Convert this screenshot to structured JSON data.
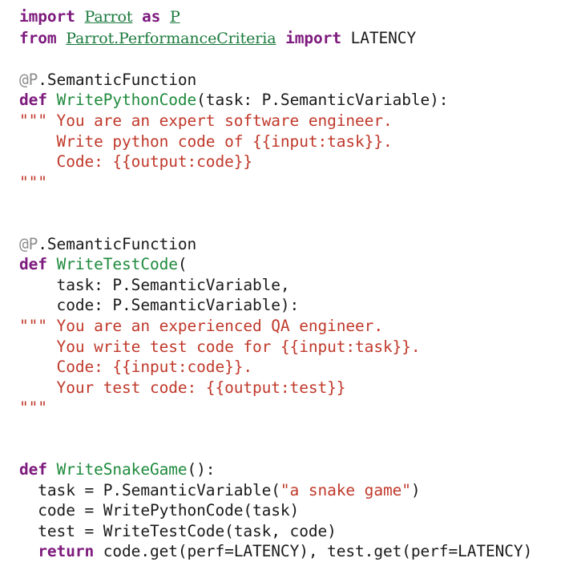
{
  "editor": {
    "title": "Parrot Semantic Function Code Listing",
    "language": "python",
    "colors": {
      "background": "#ffffff",
      "keyword": "#7d1a7d",
      "module_link": "#1a7a3c",
      "function_name": "#1e8a3c",
      "string": "#c0392b",
      "docstring": "#c0392b",
      "decorator_at": "#8c8c8c",
      "plain_text": "#1a1a1a"
    }
  },
  "lines": [
    {
      "id": "line-1",
      "tokens": [
        {
          "t": "import",
          "k": "keyword"
        },
        {
          "t": " ",
          "k": "plain"
        },
        {
          "t": "Parrot",
          "k": "module"
        },
        {
          "t": " ",
          "k": "plain"
        },
        {
          "t": "as",
          "k": "keyword"
        },
        {
          "t": " ",
          "k": "plain"
        },
        {
          "t": "P",
          "k": "module"
        }
      ]
    },
    {
      "id": "line-2",
      "tokens": [
        {
          "t": "from",
          "k": "keyword"
        },
        {
          "t": " ",
          "k": "plain"
        },
        {
          "t": "Parrot.PerformanceCriteria",
          "k": "module"
        },
        {
          "t": " ",
          "k": "plain"
        },
        {
          "t": "import",
          "k": "keyword"
        },
        {
          "t": " LATENCY",
          "k": "plain"
        }
      ]
    },
    {
      "id": "line-3",
      "blank": true,
      "tokens": []
    },
    {
      "id": "line-4",
      "tokens": [
        {
          "t": "@P",
          "k": "decorator-at"
        },
        {
          "t": ".SemanticFunction",
          "k": "plain"
        }
      ]
    },
    {
      "id": "line-5",
      "tokens": [
        {
          "t": "def",
          "k": "keyword"
        },
        {
          "t": " ",
          "k": "plain"
        },
        {
          "t": "WritePythonCode",
          "k": "funcname"
        },
        {
          "t": "(task: P.SemanticVariable):",
          "k": "plain"
        }
      ]
    },
    {
      "id": "line-6",
      "tokens": [
        {
          "t": "\"\"\" You are an expert software engineer.",
          "k": "doc"
        }
      ]
    },
    {
      "id": "line-7",
      "tokens": [
        {
          "t": "    Write python code of {{input:task}}.",
          "k": "doc"
        }
      ]
    },
    {
      "id": "line-8",
      "tokens": [
        {
          "t": "    Code: {{output:code}}",
          "k": "doc"
        }
      ]
    },
    {
      "id": "line-9",
      "tokens": [
        {
          "t": "\"\"\"",
          "k": "doc"
        }
      ]
    },
    {
      "id": "line-10",
      "blank": true,
      "tokens": []
    },
    {
      "id": "line-11",
      "blank": true,
      "tokens": []
    },
    {
      "id": "line-12",
      "tokens": [
        {
          "t": "@P",
          "k": "decorator-at"
        },
        {
          "t": ".SemanticFunction",
          "k": "plain"
        }
      ]
    },
    {
      "id": "line-13",
      "tokens": [
        {
          "t": "def",
          "k": "keyword"
        },
        {
          "t": " ",
          "k": "plain"
        },
        {
          "t": "WriteTestCode",
          "k": "funcname"
        },
        {
          "t": "(",
          "k": "plain"
        }
      ]
    },
    {
      "id": "line-14",
      "tokens": [
        {
          "t": "    task: P.SemanticVariable,",
          "k": "plain"
        }
      ]
    },
    {
      "id": "line-15",
      "tokens": [
        {
          "t": "    code: P.SemanticVariable):",
          "k": "plain"
        }
      ]
    },
    {
      "id": "line-16",
      "tokens": [
        {
          "t": "\"\"\" You are an experienced QA engineer.",
          "k": "doc"
        }
      ]
    },
    {
      "id": "line-17",
      "tokens": [
        {
          "t": "    You write test code for {{input:task}}.",
          "k": "doc"
        }
      ]
    },
    {
      "id": "line-18",
      "tokens": [
        {
          "t": "    Code: {{input:code}}.",
          "k": "doc"
        }
      ]
    },
    {
      "id": "line-19",
      "tokens": [
        {
          "t": "    Your test code: {{output:test}}",
          "k": "doc"
        }
      ]
    },
    {
      "id": "line-20",
      "tokens": [
        {
          "t": "\"\"\"",
          "k": "doc"
        }
      ]
    },
    {
      "id": "line-21",
      "blank": true,
      "tokens": []
    },
    {
      "id": "line-22",
      "blank": true,
      "tokens": []
    },
    {
      "id": "line-23",
      "tokens": [
        {
          "t": "def",
          "k": "keyword"
        },
        {
          "t": " ",
          "k": "plain"
        },
        {
          "t": "WriteSnakeGame",
          "k": "funcname"
        },
        {
          "t": "():",
          "k": "plain"
        }
      ]
    },
    {
      "id": "line-24",
      "tokens": [
        {
          "t": "  task = P.SemanticVariable(",
          "k": "plain"
        },
        {
          "t": "\"a snake game\"",
          "k": "string"
        },
        {
          "t": ")",
          "k": "plain"
        }
      ]
    },
    {
      "id": "line-25",
      "tokens": [
        {
          "t": "  code = WritePythonCode(task)",
          "k": "plain"
        }
      ]
    },
    {
      "id": "line-26",
      "tokens": [
        {
          "t": "  test = WriteTestCode(task, code)",
          "k": "plain"
        }
      ]
    },
    {
      "id": "line-27",
      "tokens": [
        {
          "t": "  ",
          "k": "plain"
        },
        {
          "t": "return",
          "k": "keyword"
        },
        {
          "t": " code.get(perf=LATENCY), test.get(perf=LATENCY)",
          "k": "plain"
        }
      ]
    }
  ]
}
